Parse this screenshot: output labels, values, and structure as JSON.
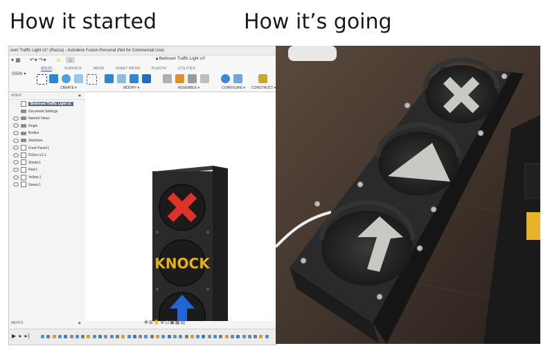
{
  "captions": {
    "left": "How it started",
    "right": "How it’s going"
  },
  "fusion": {
    "window_title": "oom Traffic Light v1* (Razza) - Autodesk Fusion Personal (Not for Commercial Use)",
    "document_tab": "Bedroom Traffic Light v1*",
    "design_menu": "SIGN ▾",
    "workspace_tabs": [
      "SOLID",
      "SURFACE",
      "MESH",
      "SHEET METAL",
      "PLASTIC",
      "UTILITIES"
    ],
    "tool_groups": [
      "CREATE ▾",
      "MODIFY ▾",
      "ASSEMBLE ▾",
      "CONFIGURE ▾",
      "CONSTRUCT ▾"
    ],
    "browser_header": "WSER",
    "tree": [
      {
        "label": "Bedroom Traffic Light v1",
        "kind": "root"
      },
      {
        "label": "Document Settings",
        "kind": "gear"
      },
      {
        "label": "Named Views",
        "kind": "folder"
      },
      {
        "label": "Origin",
        "kind": "folder"
      },
      {
        "label": "Bodies",
        "kind": "folder"
      },
      {
        "label": "Sketches",
        "kind": "folder"
      },
      {
        "label": "Front Panel:1",
        "kind": "component"
      },
      {
        "label": "PiZero v1:1",
        "kind": "component"
      },
      {
        "label": "Shield:1",
        "kind": "component"
      },
      {
        "label": "Red:1",
        "kind": "component"
      },
      {
        "label": "Yellow:1",
        "kind": "component"
      },
      {
        "label": "Green:1",
        "kind": "component"
      }
    ],
    "comments_label": "MENTS",
    "model_text": "KNOCK",
    "colors": {
      "accent": "#1d4fa3",
      "red_cross": "#e0302a",
      "knock_text": "#e8b41c",
      "blue_arrow": "#2465d6",
      "housing": "#2a2a2a"
    }
  }
}
